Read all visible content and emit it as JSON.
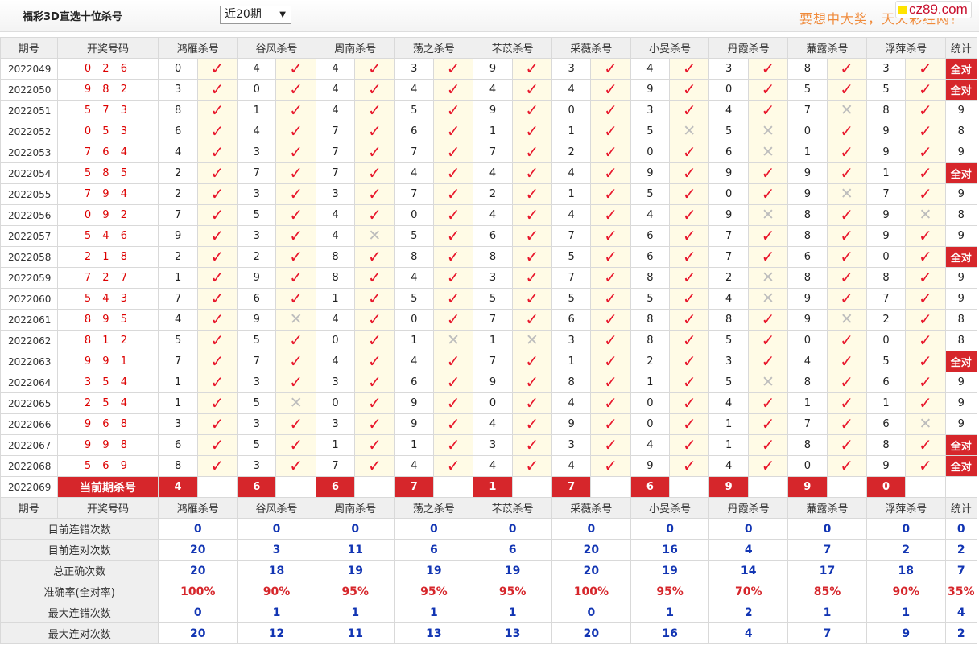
{
  "header": {
    "title": "福彩3D直选十位杀号",
    "period_select": "近20期",
    "marquee": "要想中大奖，天天彩经网！",
    "logo": "cz89.com"
  },
  "columns": {
    "issue": "期号",
    "nums": "开奖号码",
    "experts": [
      "鸿雁杀号",
      "谷风杀号",
      "周南杀号",
      "荡之杀号",
      "芣苡杀号",
      "采薇杀号",
      "小旻杀号",
      "丹霞杀号",
      "蒹露杀号",
      "浮萍杀号"
    ],
    "stat": "统计"
  },
  "rows": [
    {
      "issue": "2022049",
      "nums": "0 2 6",
      "kills": [
        0,
        4,
        4,
        3,
        9,
        3,
        4,
        3,
        8,
        3
      ],
      "hits": [
        1,
        1,
        1,
        1,
        1,
        1,
        1,
        1,
        1,
        1
      ],
      "stat": "全对"
    },
    {
      "issue": "2022050",
      "nums": "9 8 2",
      "kills": [
        3,
        0,
        4,
        4,
        4,
        4,
        9,
        0,
        5,
        5
      ],
      "hits": [
        1,
        1,
        1,
        1,
        1,
        1,
        1,
        1,
        1,
        1
      ],
      "stat": "全对"
    },
    {
      "issue": "2022051",
      "nums": "5 7 3",
      "kills": [
        8,
        1,
        4,
        5,
        9,
        0,
        3,
        4,
        7,
        8
      ],
      "hits": [
        1,
        1,
        1,
        1,
        1,
        1,
        1,
        1,
        0,
        1
      ],
      "stat": "9"
    },
    {
      "issue": "2022052",
      "nums": "0 5 3",
      "kills": [
        6,
        4,
        7,
        6,
        1,
        1,
        5,
        5,
        0,
        9
      ],
      "hits": [
        1,
        1,
        1,
        1,
        1,
        1,
        0,
        0,
        1,
        1
      ],
      "stat": "8"
    },
    {
      "issue": "2022053",
      "nums": "7 6 4",
      "kills": [
        4,
        3,
        7,
        7,
        7,
        2,
        0,
        6,
        1,
        9
      ],
      "hits": [
        1,
        1,
        1,
        1,
        1,
        1,
        1,
        0,
        1,
        1
      ],
      "stat": "9"
    },
    {
      "issue": "2022054",
      "nums": "5 8 5",
      "kills": [
        2,
        7,
        7,
        4,
        4,
        4,
        9,
        9,
        9,
        1
      ],
      "hits": [
        1,
        1,
        1,
        1,
        1,
        1,
        1,
        1,
        1,
        1
      ],
      "stat": "全对"
    },
    {
      "issue": "2022055",
      "nums": "7 9 4",
      "kills": [
        2,
        3,
        3,
        7,
        2,
        1,
        5,
        0,
        9,
        7
      ],
      "hits": [
        1,
        1,
        1,
        1,
        1,
        1,
        1,
        1,
        0,
        1
      ],
      "stat": "9"
    },
    {
      "issue": "2022056",
      "nums": "0 9 2",
      "kills": [
        7,
        5,
        4,
        0,
        4,
        4,
        4,
        9,
        8,
        9
      ],
      "hits": [
        1,
        1,
        1,
        1,
        1,
        1,
        1,
        0,
        1,
        0
      ],
      "stat": "8"
    },
    {
      "issue": "2022057",
      "nums": "5 4 6",
      "kills": [
        9,
        3,
        4,
        5,
        6,
        7,
        6,
        7,
        8,
        9
      ],
      "hits": [
        1,
        1,
        0,
        1,
        1,
        1,
        1,
        1,
        1,
        1
      ],
      "stat": "9"
    },
    {
      "issue": "2022058",
      "nums": "2 1 8",
      "kills": [
        2,
        2,
        8,
        8,
        8,
        5,
        6,
        7,
        6,
        0
      ],
      "hits": [
        1,
        1,
        1,
        1,
        1,
        1,
        1,
        1,
        1,
        1
      ],
      "stat": "全对"
    },
    {
      "issue": "2022059",
      "nums": "7 2 7",
      "kills": [
        1,
        9,
        8,
        4,
        3,
        7,
        8,
        2,
        8,
        8
      ],
      "hits": [
        1,
        1,
        1,
        1,
        1,
        1,
        1,
        0,
        1,
        1
      ],
      "stat": "9"
    },
    {
      "issue": "2022060",
      "nums": "5 4 3",
      "kills": [
        7,
        6,
        1,
        5,
        5,
        5,
        5,
        4,
        9,
        7
      ],
      "hits": [
        1,
        1,
        1,
        1,
        1,
        1,
        1,
        0,
        1,
        1
      ],
      "stat": "9"
    },
    {
      "issue": "2022061",
      "nums": "8 9 5",
      "kills": [
        4,
        9,
        4,
        0,
        7,
        6,
        8,
        8,
        9,
        2
      ],
      "hits": [
        1,
        0,
        1,
        1,
        1,
        1,
        1,
        1,
        0,
        1
      ],
      "stat": "8"
    },
    {
      "issue": "2022062",
      "nums": "8 1 2",
      "kills": [
        5,
        5,
        0,
        1,
        1,
        3,
        8,
        5,
        0,
        0
      ],
      "hits": [
        1,
        1,
        1,
        0,
        0,
        1,
        1,
        1,
        1,
        1
      ],
      "stat": "8"
    },
    {
      "issue": "2022063",
      "nums": "9 9 1",
      "kills": [
        7,
        7,
        4,
        4,
        7,
        1,
        2,
        3,
        4,
        5
      ],
      "hits": [
        1,
        1,
        1,
        1,
        1,
        1,
        1,
        1,
        1,
        1
      ],
      "stat": "全对"
    },
    {
      "issue": "2022064",
      "nums": "3 5 4",
      "kills": [
        1,
        3,
        3,
        6,
        9,
        8,
        1,
        5,
        8,
        6
      ],
      "hits": [
        1,
        1,
        1,
        1,
        1,
        1,
        1,
        0,
        1,
        1
      ],
      "stat": "9"
    },
    {
      "issue": "2022065",
      "nums": "2 5 4",
      "kills": [
        1,
        5,
        0,
        9,
        0,
        4,
        0,
        4,
        1,
        1
      ],
      "hits": [
        1,
        0,
        1,
        1,
        1,
        1,
        1,
        1,
        1,
        1
      ],
      "stat": "9"
    },
    {
      "issue": "2022066",
      "nums": "9 6 8",
      "kills": [
        3,
        3,
        3,
        9,
        4,
        9,
        0,
        1,
        7,
        6
      ],
      "hits": [
        1,
        1,
        1,
        1,
        1,
        1,
        1,
        1,
        1,
        0
      ],
      "stat": "9"
    },
    {
      "issue": "2022067",
      "nums": "9 9 8",
      "kills": [
        6,
        5,
        1,
        1,
        3,
        3,
        4,
        1,
        8,
        8
      ],
      "hits": [
        1,
        1,
        1,
        1,
        1,
        1,
        1,
        1,
        1,
        1
      ],
      "stat": "全对"
    },
    {
      "issue": "2022068",
      "nums": "5 6 9",
      "kills": [
        8,
        3,
        7,
        4,
        4,
        4,
        9,
        4,
        0,
        9
      ],
      "hits": [
        1,
        1,
        1,
        1,
        1,
        1,
        1,
        1,
        1,
        1
      ],
      "stat": "全对"
    }
  ],
  "current": {
    "issue": "2022069",
    "label": "当前期杀号",
    "kills": [
      4,
      6,
      6,
      7,
      1,
      7,
      6,
      9,
      9,
      0
    ]
  },
  "summary": [
    {
      "label": "目前连错次数",
      "values": [
        "0",
        "0",
        "0",
        "0",
        "0",
        "0",
        "0",
        "0",
        "0",
        "0"
      ],
      "stat": "0",
      "red": false
    },
    {
      "label": "目前连对次数",
      "values": [
        "20",
        "3",
        "11",
        "6",
        "6",
        "20",
        "16",
        "4",
        "7",
        "2"
      ],
      "stat": "2",
      "red": false
    },
    {
      "label": "总正确次数",
      "values": [
        "20",
        "18",
        "19",
        "19",
        "19",
        "20",
        "19",
        "14",
        "17",
        "18"
      ],
      "stat": "7",
      "red": false
    },
    {
      "label": "准确率(全对率)",
      "values": [
        "100%",
        "90%",
        "95%",
        "95%",
        "95%",
        "100%",
        "95%",
        "70%",
        "85%",
        "90%"
      ],
      "stat": "35%",
      "red": true
    },
    {
      "label": "最大连错次数",
      "values": [
        "0",
        "1",
        "1",
        "1",
        "1",
        "0",
        "1",
        "2",
        "1",
        "1"
      ],
      "stat": "4",
      "red": false
    },
    {
      "label": "最大连对次数",
      "values": [
        "20",
        "12",
        "11",
        "13",
        "13",
        "20",
        "16",
        "4",
        "7",
        "9"
      ],
      "stat": "2",
      "red": false
    }
  ],
  "icons": {
    "hit": "check-icon",
    "miss": "cross-icon"
  },
  "colors": {
    "accent": "#d6262b",
    "hit": "#e8162b",
    "miss": "#bdbdbd",
    "summary_value": "#1235b3",
    "number": "#dd0000"
  }
}
